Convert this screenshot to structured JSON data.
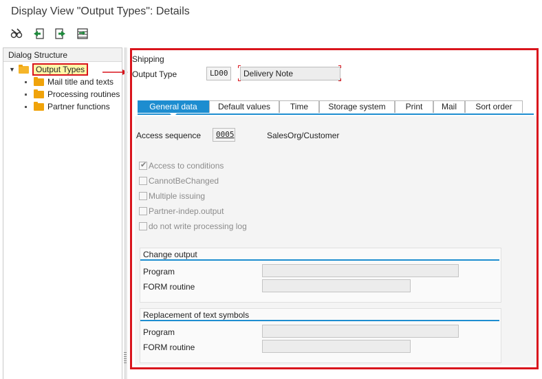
{
  "window": {
    "title": "Display View \"Output Types\": Details"
  },
  "toolbar": {
    "buttons": [
      {
        "icon": "glasses-icon",
        "name": "display-change-button"
      },
      {
        "icon": "previous-entry-icon",
        "name": "previous-entry-button"
      },
      {
        "icon": "next-entry-icon",
        "name": "next-entry-button"
      },
      {
        "icon": "variable-list-icon",
        "name": "variable-list-button"
      }
    ]
  },
  "tree": {
    "header": "Dialog Structure",
    "root": {
      "label": "Output Types",
      "expanded": true,
      "selected": true
    },
    "children": [
      {
        "label": "Mail title and texts"
      },
      {
        "label": "Processing routines"
      },
      {
        "label": "Partner functions"
      }
    ]
  },
  "detail": {
    "application_label": "Shipping",
    "output_type_label": "Output Type",
    "output_type_value": "LD00",
    "output_type_desc": "Delivery Note",
    "tabs": [
      {
        "label": "General data",
        "active": true
      },
      {
        "label": "Default values"
      },
      {
        "label": "Time"
      },
      {
        "label": "Storage system"
      },
      {
        "label": "Print"
      },
      {
        "label": "Mail"
      },
      {
        "label": "Sort order"
      }
    ],
    "access_sequence_label": "Access sequence",
    "access_sequence_value": "0005",
    "access_sequence_desc": "SalesOrg/Customer",
    "checkboxes": [
      {
        "label": "Access to conditions",
        "checked": true
      },
      {
        "label": "CannotBeChanged",
        "checked": false
      },
      {
        "label": "Multiple issuing",
        "checked": false
      },
      {
        "label": "Partner-indep.output",
        "checked": false
      },
      {
        "label": "do not write processing log",
        "checked": false
      }
    ],
    "change_output": {
      "title": "Change output",
      "program_label": "Program",
      "program_value": "",
      "form_routine_label": "FORM routine",
      "form_routine_value": ""
    },
    "replacement": {
      "title": "Replacement of text symbols",
      "program_label": "Program",
      "program_value": "",
      "form_routine_label": "FORM routine",
      "form_routine_value": ""
    }
  },
  "colors": {
    "highlight_border": "#d9141c",
    "accent_blue": "#1d8dd0",
    "folder": "#f0a30a",
    "selected_bg": "#fff7a8"
  }
}
